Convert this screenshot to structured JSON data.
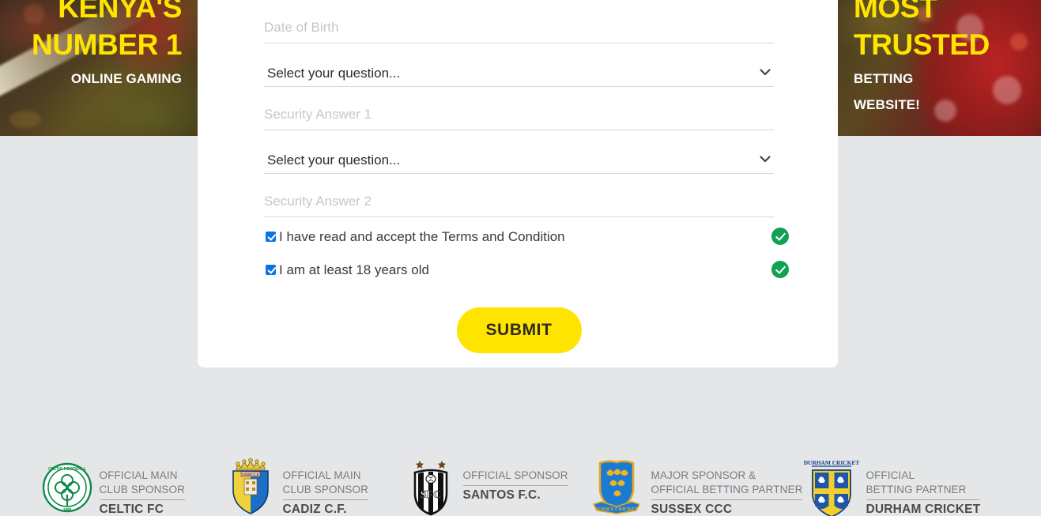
{
  "banners": {
    "left": {
      "headline_line1": "KENYA'S",
      "headline_line2": "NUMBER 1",
      "subline1": "ONLINE GAMING",
      "accent_color": "#ffe400"
    },
    "right": {
      "headline_line1": "MOST",
      "headline_line2": "TRUSTED",
      "subline1": "BETTING",
      "subline2": "WEBSITE!",
      "accent_color": "#ffe400"
    }
  },
  "form": {
    "dob": {
      "placeholder": "Date of Birth",
      "value": ""
    },
    "question1": {
      "selected": "Select your question...",
      "options": [
        "Select your question..."
      ]
    },
    "answer1": {
      "placeholder": "Security Answer 1",
      "value": ""
    },
    "question2": {
      "selected": "Select your question...",
      "options": [
        "Select your question..."
      ]
    },
    "answer2": {
      "placeholder": "Security Answer 2",
      "value": ""
    },
    "terms_label": "I have read and accept the Terms and Condition",
    "age_label": "I am at least 18 years old",
    "submit_label": "SUBMIT",
    "submit_color": "#ffe400",
    "valid_color": "#12a052",
    "checkbox_color": "#0b74e5"
  },
  "sponsors": [
    {
      "role_line1": "OFFICIAL MAIN",
      "role_line2": "CLUB SPONSOR",
      "name": "CELTIC FC",
      "logo": "celtic-fc-crest-icon"
    },
    {
      "role_line1": "OFFICIAL MAIN",
      "role_line2": "CLUB SPONSOR",
      "name": "CADIZ C.F.",
      "logo": "cadiz-cf-crest-icon"
    },
    {
      "role_line1": "OFFICIAL SPONSOR",
      "role_line2": "",
      "name": "SANTOS F.C.",
      "logo": "santos-fc-crest-icon"
    },
    {
      "role_line1": "MAJOR SPONSOR &",
      "role_line2": "OFFICIAL BETTING PARTNER",
      "name": "SUSSEX CCC",
      "logo": "sussex-ccc-crest-icon"
    },
    {
      "role_line1": "OFFICIAL",
      "role_line2": "BETTING PARTNER",
      "name": "DURHAM CRICKET",
      "logo": "durham-cricket-crest-icon"
    }
  ],
  "page": {
    "background_color": "#e5e6e8",
    "card_color": "#ffffff"
  }
}
